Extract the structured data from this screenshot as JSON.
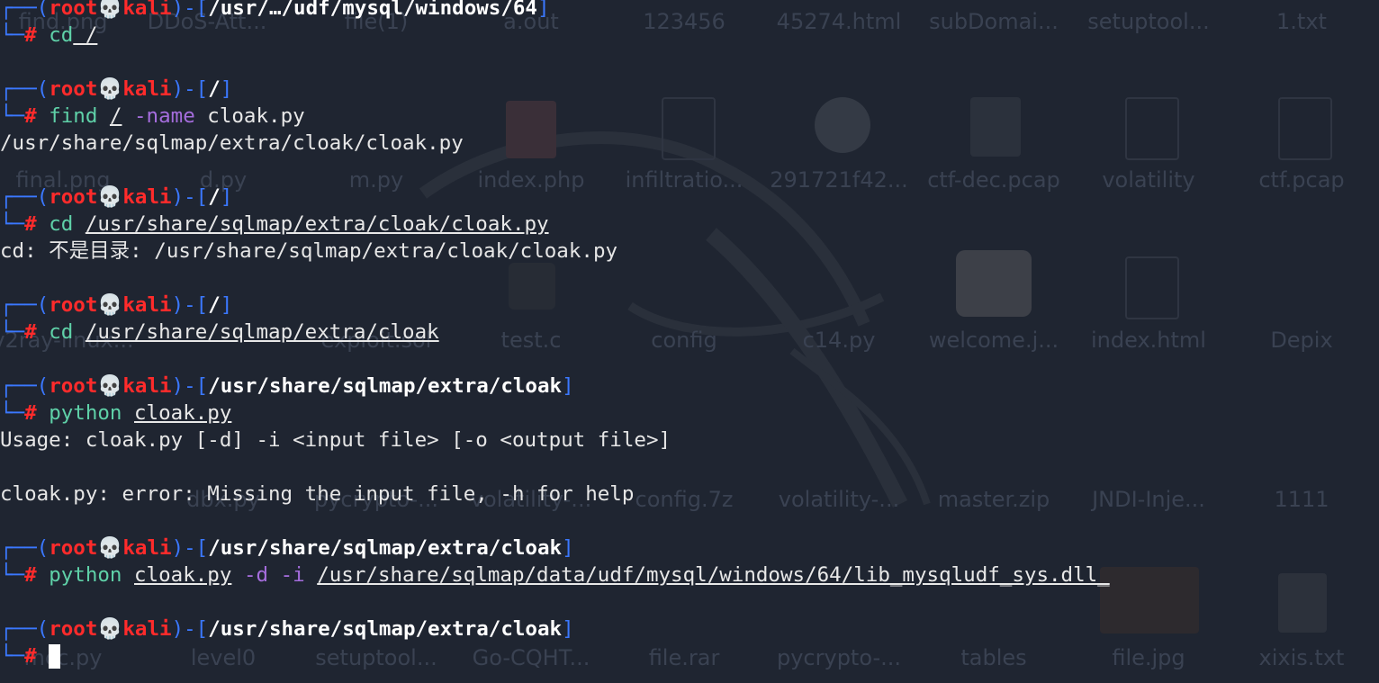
{
  "desktop": {
    "icon_labels": [
      "find.png",
      "DDoS-Att...",
      "file(1)",
      "a.out",
      "123456",
      "45274.html",
      "subDomai...",
      "setuptool...",
      "1.txt",
      "final.png",
      "d.py",
      "m.py",
      "index.php",
      "infiltratio...",
      "291721f42...",
      "ctf-dec.pcap",
      "volatility",
      "ctf.pcap",
      "v2ray-linux...",
      "",
      "exploit.sol",
      "test.c",
      "config",
      "c14.py",
      "welcome.j...",
      "index.html",
      "Depix",
      "dbx.py",
      "pycrypto-...",
      "volatility-...",
      "config.7z",
      "volatility-...",
      "master.zip",
      "JNDI-Inje...",
      "1111",
      "mcc.py",
      "level0",
      "setuptool...",
      "Go-CQHT...",
      "file.rar",
      "pycrypto-...",
      "tables",
      "file.jpg",
      "xixis.txt"
    ]
  },
  "terminal": {
    "prompt": {
      "frame_top": "┌──(",
      "frame_close": ")-[",
      "frame_bottom": "└─",
      "user": "root",
      "skull": "💀",
      "host": "kali",
      "symbol": "#"
    },
    "blocks": [
      {
        "path": "/usr/…/udf/mysql/windows/64",
        "cmd": "cd",
        "args": " /"
      },
      {
        "path": "/",
        "cmd": "find",
        "a1": "/",
        "opt": "-name",
        "a2": "cloak.py",
        "output": "/usr/share/sqlmap/extra/cloak/cloak.py"
      },
      {
        "path": "/",
        "cmd": "cd",
        "a1": "/usr/share/sqlmap/extra/cloak/cloak.py",
        "output": "cd: 不是目录: /usr/share/sqlmap/extra/cloak/cloak.py"
      },
      {
        "path": "/",
        "cmd": "cd",
        "a1": "/usr/share/sqlmap/extra/cloak"
      },
      {
        "path": "/usr/share/sqlmap/extra/cloak",
        "cmd": "python",
        "a1": "cloak.py",
        "output1": "Usage: cloak.py [-d] -i <input file> [-o <output file>]",
        "output2": "cloak.py: error: Missing the input file, -h for help"
      },
      {
        "path": "/usr/share/sqlmap/extra/cloak",
        "cmd": "python",
        "a1": "cloak.py",
        "opt1": "-d",
        "opt2": "-i",
        "a2": "/usr/share/sqlmap/data/udf/mysql/windows/64/lib_mysqludf_sys.dll_"
      },
      {
        "path": "/usr/share/sqlmap/extra/cloak"
      }
    ]
  }
}
